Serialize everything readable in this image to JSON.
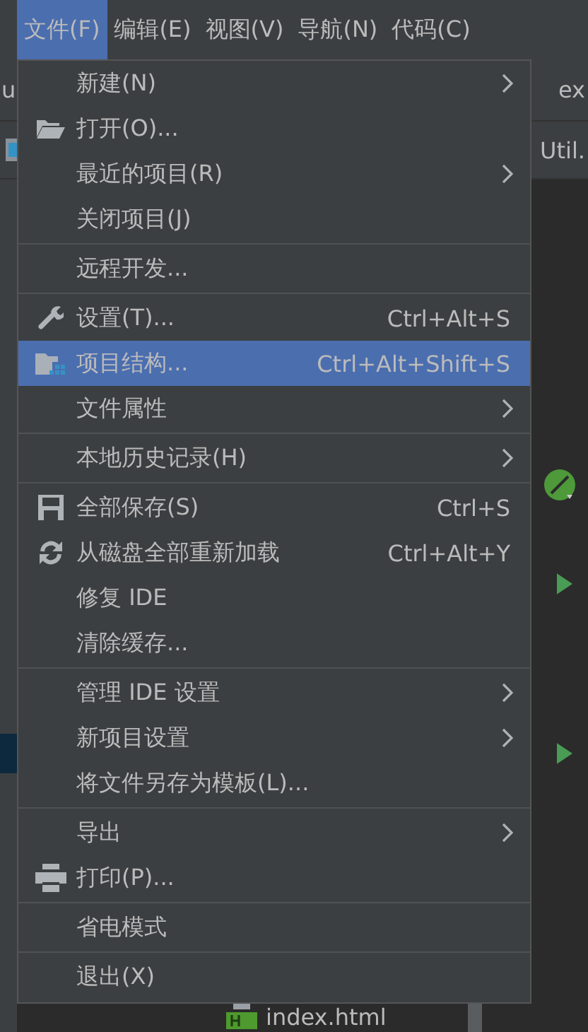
{
  "menubar": [
    {
      "label": "文件(F)",
      "selected": true
    },
    {
      "label": "编辑(E)",
      "selected": false
    },
    {
      "label": "视图(V)",
      "selected": false
    },
    {
      "label": "导航(N)",
      "selected": false
    },
    {
      "label": "代码(C)",
      "selected": false
    }
  ],
  "editor": {
    "tab_left": "u",
    "tab_right": "ex",
    "file_tab": "Util.",
    "project_file": "index.html"
  },
  "menu": [
    {
      "kind": "item",
      "label": "新建(N)",
      "submenu": true,
      "selected": false
    },
    {
      "kind": "item",
      "label": "打开(O)...",
      "selected": false
    },
    {
      "kind": "item",
      "label": "最近的项目(R)",
      "submenu": true,
      "selected": false
    },
    {
      "kind": "item",
      "label": "关闭项目(J)",
      "selected": false
    },
    {
      "kind": "separator"
    },
    {
      "kind": "item",
      "label": "远程开发...",
      "selected": false
    },
    {
      "kind": "separator"
    },
    {
      "kind": "item",
      "label": "设置(T)...",
      "shortcut": "Ctrl+Alt+S",
      "selected": false
    },
    {
      "kind": "item",
      "label": "项目结构...",
      "shortcut": "Ctrl+Alt+Shift+S",
      "selected": true
    },
    {
      "kind": "item",
      "label": "文件属性",
      "submenu": true,
      "selected": false
    },
    {
      "kind": "separator"
    },
    {
      "kind": "item",
      "label": "本地历史记录(H)",
      "submenu": true,
      "selected": false
    },
    {
      "kind": "separator"
    },
    {
      "kind": "item",
      "label": "全部保存(S)",
      "shortcut": "Ctrl+S",
      "selected": false
    },
    {
      "kind": "item",
      "label": "从磁盘全部重新加载",
      "shortcut": "Ctrl+Alt+Y",
      "selected": false
    },
    {
      "kind": "item",
      "label": "修复 IDE",
      "selected": false
    },
    {
      "kind": "item",
      "label": "清除缓存...",
      "selected": false
    },
    {
      "kind": "separator"
    },
    {
      "kind": "item",
      "label": "管理 IDE 设置",
      "submenu": true,
      "selected": false
    },
    {
      "kind": "item",
      "label": "新项目设置",
      "submenu": true,
      "selected": false
    },
    {
      "kind": "item",
      "label": "将文件另存为模板(L)...",
      "selected": false
    },
    {
      "kind": "separator"
    },
    {
      "kind": "item",
      "label": "导出",
      "submenu": true,
      "selected": false
    },
    {
      "kind": "item",
      "label": "打印(P)...",
      "selected": false
    },
    {
      "kind": "separator"
    },
    {
      "kind": "item",
      "label": "省电模式",
      "selected": false
    },
    {
      "kind": "separator"
    },
    {
      "kind": "item",
      "label": "退出(X)",
      "selected": false
    }
  ]
}
